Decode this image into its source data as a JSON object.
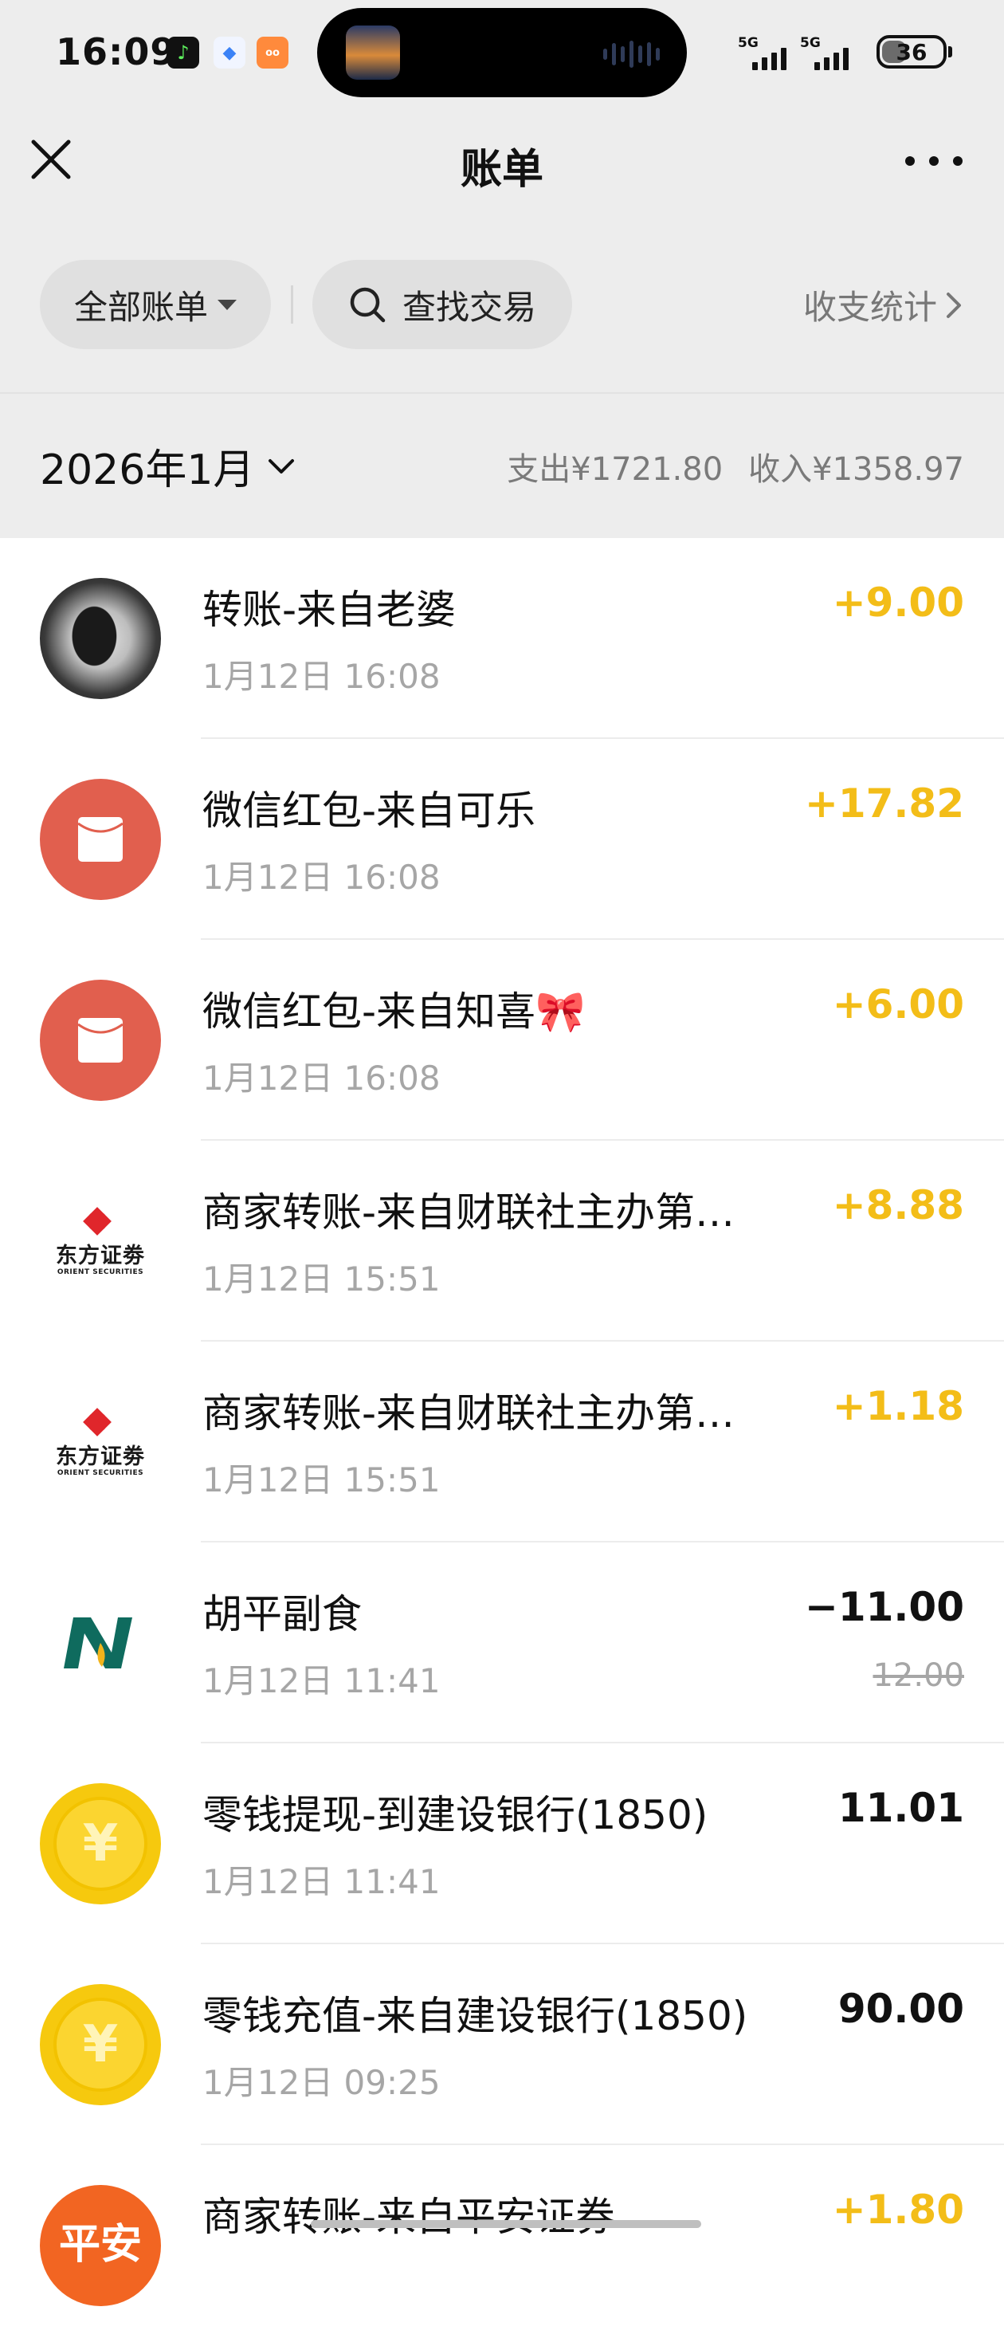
{
  "status_bar": {
    "time": "16:09",
    "network_1": "5G",
    "network_2": "5G",
    "battery": "36"
  },
  "nav": {
    "title": "账单"
  },
  "filters": {
    "all_bills": "全部账单",
    "search": "查找交易",
    "stats": "收支统计"
  },
  "month": {
    "label": "2026年1月",
    "expense": "支出¥1721.80",
    "income": "收入¥1358.97"
  },
  "transactions": [
    {
      "title": "转账-来自老婆",
      "time": "1月12日 16:08",
      "amount": "+9.00",
      "type": "income",
      "icon": "avatar"
    },
    {
      "title": "微信红包-来自可乐",
      "time": "1月12日 16:08",
      "amount": "+17.82",
      "type": "income",
      "icon": "red-packet-icon"
    },
    {
      "title": "微信红包-来自知喜🎀",
      "time": "1月12日 16:08",
      "amount": "+6.00",
      "type": "income",
      "icon": "red-packet-icon"
    },
    {
      "title": "商家转账-来自财联社主办第…",
      "time": "1月12日 15:51",
      "amount": "+8.88",
      "type": "income",
      "icon": "orient-securities-logo",
      "logo_text": "东方证劵",
      "logo_sub": "ORIENT SECURITIES"
    },
    {
      "title": "商家转账-来自财联社主办第…",
      "time": "1月12日 15:51",
      "amount": "+1.18",
      "type": "income",
      "icon": "orient-securities-logo",
      "logo_text": "东方证劵",
      "logo_sub": "ORIENT SECURITIES"
    },
    {
      "title": "胡平副食",
      "time": "1月12日 11:41",
      "amount": "−11.00",
      "original": "12.00",
      "type": "expense",
      "icon": "merchant-logo"
    },
    {
      "title": "零钱提现-到建设银行(1850)",
      "time": "1月12日 11:41",
      "amount": "11.01",
      "type": "neutral",
      "icon": "coin-icon",
      "coin_symbol": "¥"
    },
    {
      "title": "零钱充值-来自建设银行(1850)",
      "time": "1月12日 09:25",
      "amount": "90.00",
      "type": "neutral",
      "icon": "coin-icon",
      "coin_symbol": "¥"
    },
    {
      "title": "商家转账-来自平安证券",
      "time": "",
      "amount": "+1.80",
      "type": "income",
      "icon": "pingan-logo",
      "logo_text": "平安"
    }
  ],
  "colors": {
    "income": "#f3bd18",
    "red_packet": "#e15f4e",
    "coin": "#f6c90e",
    "background_top": "#ededed"
  }
}
